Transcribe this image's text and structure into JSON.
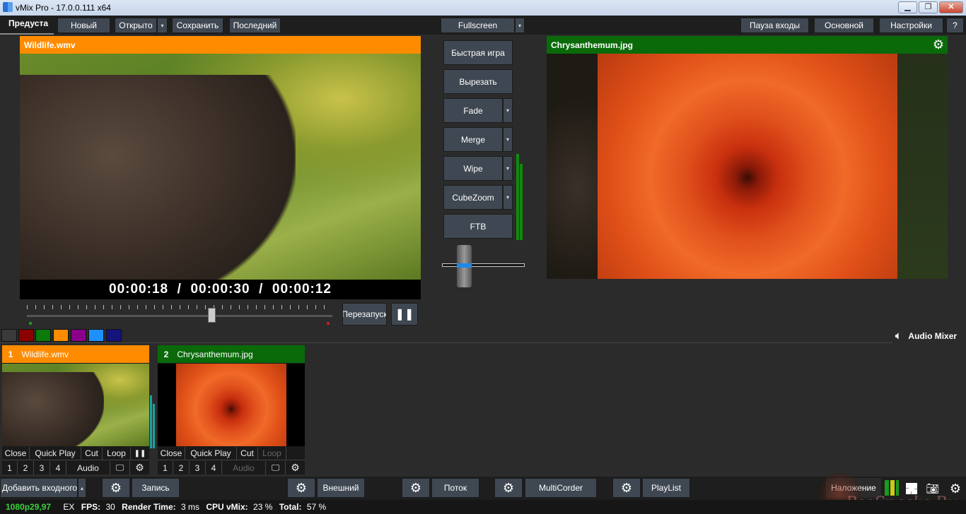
{
  "window": {
    "title": "vMix Pro - 17.0.0.111 x64",
    "minimize": "▁",
    "restore": "❐",
    "close": "✕"
  },
  "menubar": {
    "preview_tab": "Предуста",
    "new": "Новый",
    "open": "Открыто",
    "save": "Сохранить",
    "recent": "Последний",
    "fullscreen": "Fullscreen",
    "pause_inputs": "Пауза входы",
    "main": "Основной",
    "settings": "Настройки",
    "help": "?"
  },
  "preview": {
    "title": "Wildlife.wmv",
    "timecode": "00:00:18  /  00:00:30  /  00:00:12",
    "restart": "Перезапуск",
    "pause_icon": "❚❚"
  },
  "output": {
    "title": "Chrysanthemum.jpg"
  },
  "transitions": {
    "quick_play": "Быстрая игра",
    "cut": "Вырезать",
    "fade": "Fade",
    "merge": "Merge",
    "wipe": "Wipe",
    "cubezoom": "CubeZoom",
    "ftb": "FTB"
  },
  "colors": {
    "accent_orange": "#ff8c00",
    "accent_green": "#0a6a0a",
    "tags": [
      "#8b0000",
      "#0b7a0b",
      "#ff8c00",
      "#8b008b",
      "#1e90ff",
      "#14147a"
    ]
  },
  "audio_mixer": {
    "label": "Audio Mixer"
  },
  "inputs": [
    {
      "number": "1",
      "title": "Wildlife.wmv",
      "controls": [
        "Close",
        "Quick Play",
        "Cut",
        "Loop",
        "❚❚"
      ],
      "overlays": [
        "1",
        "2",
        "3",
        "4"
      ],
      "audio": "Audio"
    },
    {
      "number": "2",
      "title": "Chrysanthemum.jpg",
      "controls": [
        "Close",
        "Quick Play",
        "Cut",
        "Loop"
      ],
      "overlays": [
        "1",
        "2",
        "3",
        "4"
      ],
      "audio": "Audio"
    }
  ],
  "bottombar": {
    "add_input": "Добавить входного",
    "record": "Запись",
    "external": "Внешний",
    "stream": "Поток",
    "multicorder": "MultiCorder",
    "playlist": "PlayList",
    "overlay": "Наложение"
  },
  "status": {
    "format": "1080p29,97",
    "ex": "EX",
    "fps_label": "FPS:",
    "fps": "30",
    "render_label": "Render Time:",
    "render": "3 ms",
    "cpu_label": "CPU vMix:",
    "cpu": "23 %",
    "total_label": "Total:",
    "total": "57 %"
  },
  "watermark": "PcoSnacks.Ru"
}
